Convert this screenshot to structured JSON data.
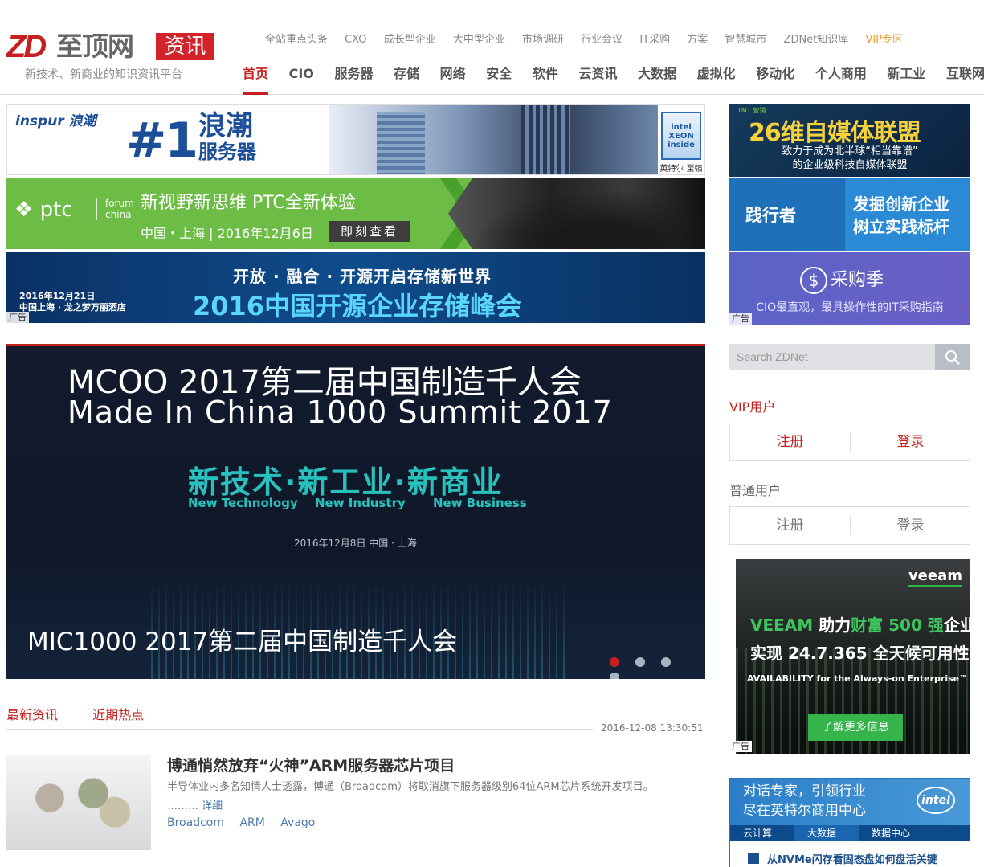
{
  "logo": {
    "mark": "ZD",
    "name": "至顶网",
    "tag": "资讯",
    "slogan": "新技术、新商业的知识资讯平台"
  },
  "top_nav": [
    "全站重点头条",
    "CXO",
    "成长型企业",
    "大中型企业",
    "市场调研",
    "行业会议",
    "IT采购",
    "方案",
    "智慧城市",
    "ZDNet知识库",
    "VIP专区"
  ],
  "main_nav": [
    {
      "label": "首页",
      "active": true
    },
    {
      "label": "CIO"
    },
    {
      "label": "服务器"
    },
    {
      "label": "存储"
    },
    {
      "label": "网络"
    },
    {
      "label": "安全"
    },
    {
      "label": "软件"
    },
    {
      "label": "云资讯"
    },
    {
      "label": "大数据"
    },
    {
      "label": "虚拟化"
    },
    {
      "label": "移动化"
    },
    {
      "label": "个人商用"
    },
    {
      "label": "新工业"
    },
    {
      "label": "互联网+"
    }
  ],
  "banners": {
    "inspur": {
      "brand": "inspur 浪潮",
      "big": "#1",
      "sub1": "浪潮",
      "sub2": "服务器",
      "chip_text": "intel XEON inside",
      "chip_label": "英特尔 至强"
    },
    "ptc": {
      "logo": "ptc",
      "forum": "forum",
      "forum2": "china",
      "title": "新视野新思维 PTC全新体验",
      "sub": "中国・上海 | 2016年12月6日",
      "button": "即刻查看"
    },
    "storage": {
      "slogan": "开放 · 融合 · 开源开启存储新世界",
      "title": "2016中国开源企业存储峰会",
      "date": "2016年12月21日",
      "venue": "中国上海 · 龙之梦万丽酒店",
      "ad": "广告"
    }
  },
  "slider": {
    "line1": "MCOO 2017第二届中国制造千人会",
    "line2": "Made In China 1000 Summit 2017",
    "line3": "新技术·新工业·新商业",
    "en1": "New Technology",
    "en2": "New Industry",
    "en3": "New Business",
    "date": "2016年12月8日   中国 · 上海",
    "caption": "MIC1000 2017第二届中国制造千人会",
    "active_slide": 1,
    "slide_count": 4
  },
  "news_tabs": [
    "最新资讯",
    "近期热点"
  ],
  "news_time": "2016-12-08 13:30:51",
  "news_item": {
    "title": "博通悄然放弃“火神”ARM服务器芯片项目",
    "summary": "半导体业内多名知情人士透露，博通（Broadcom）将取消旗下服务器级别64位ARM芯片系统开发项目。",
    "ellipsis": "………",
    "more": "详细",
    "tags": [
      "Broadcom",
      "ARM",
      "Avago"
    ]
  },
  "side": {
    "media": {
      "logo": "TMT 营销",
      "title": "26维自媒体联盟",
      "sub1": "致力于成为北半球“相当靠谱”",
      "sub2": "的企业级科技自媒体联盟"
    },
    "practice": {
      "brand": "践行者",
      "line1": "发掘创新企业",
      "line2": "树立实践标杆"
    },
    "purchase": {
      "coin": "$",
      "title": "采购季",
      "sub": "CIO最直观，最具操作性的IT采购指南",
      "ad": "广告"
    }
  },
  "search": {
    "placeholder": "Search ZDNet"
  },
  "vip_user": {
    "label": "VIP用户",
    "register": "注册",
    "login": "登录"
  },
  "normal_user": {
    "label": "普通用户",
    "register": "注册",
    "login": "登录"
  },
  "veeam": {
    "logo": "veeam",
    "line1a": "VEEAM",
    "line1b": "助力",
    "line1c": "财富 500 强",
    "line1d": "企业",
    "line2": "实现 24.7.365 全天候可用性",
    "line3": "AVAILABILITY for the Always-on Enterprise™",
    "button": "了解更多信息",
    "ad": "广告"
  },
  "intel": {
    "line1": "对话专家，引领行业",
    "line2": "尽在英特尔商用中心",
    "logo": "intel",
    "tabs": [
      "云计算",
      "大数据",
      "数据中心"
    ],
    "item": "从NVMe闪存看固态盘如何盘活关键"
  },
  "colors": {
    "brand_red": "#c3201f",
    "vip_gold": "#e8a02a",
    "link_blue": "#4a7ab0"
  }
}
